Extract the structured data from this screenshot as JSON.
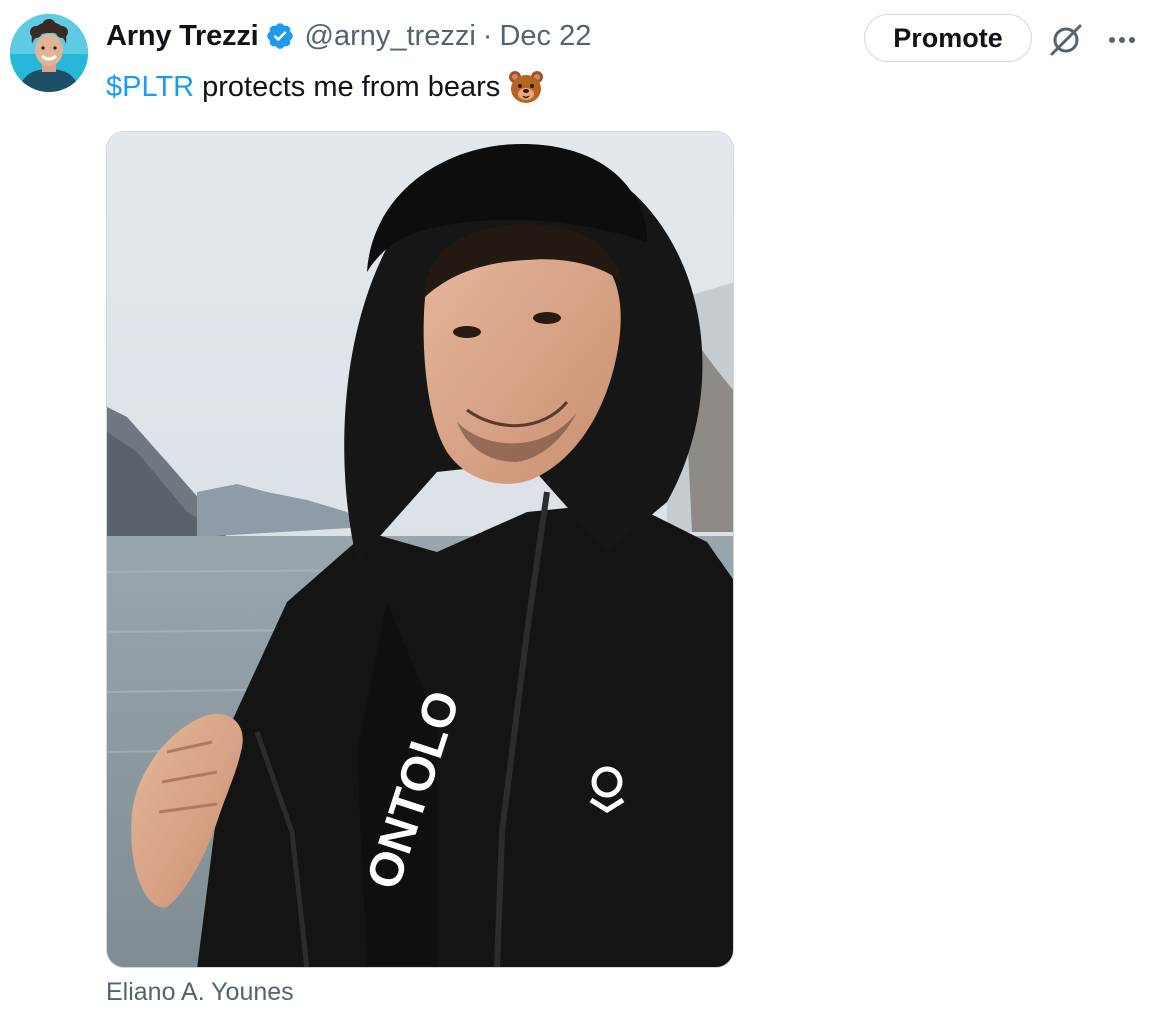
{
  "author": {
    "name": "Arny Trezzi",
    "handle": "@arny_trezzi",
    "separator": "·",
    "date": "Dec 22",
    "verified": true
  },
  "actions": {
    "promote_label": "Promote"
  },
  "tweet": {
    "cashtag": "$PLTR",
    "text": "protects me from bears",
    "emoji": "bear-face"
  },
  "media": {
    "alt": "Photo: man in a black hooded jacket smiling by a lake with mountains",
    "shirt_text": "ONTOLO"
  },
  "photo_credit": "Eliano A. Younes",
  "colors": {
    "link": "#1d9bf0",
    "verified": "#1d9bf0",
    "secondary_text": "#536471",
    "border": "#cfd9de"
  }
}
